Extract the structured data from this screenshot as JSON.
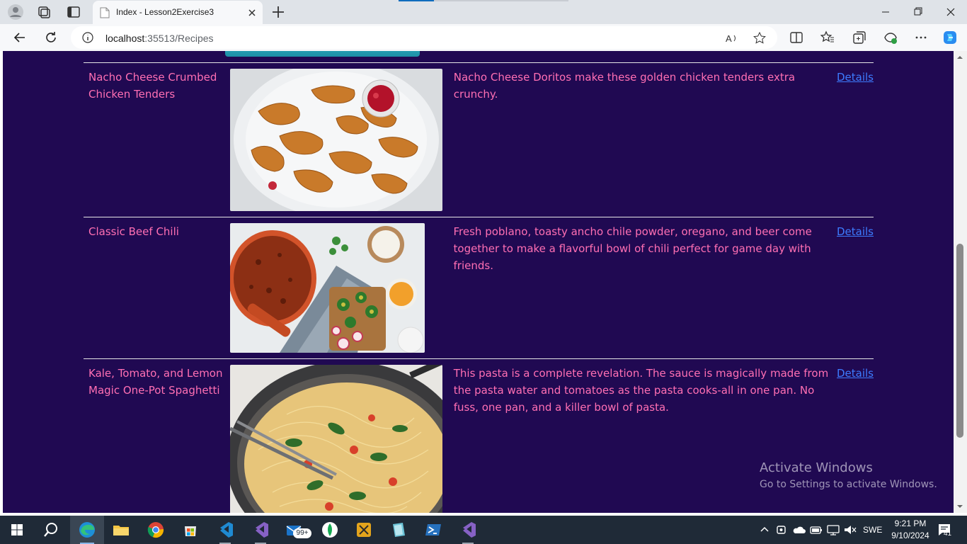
{
  "browser": {
    "tab_title": "Index - Lesson2Exercise3",
    "url_host": "localhost",
    "url_path": ":35513/Recipes"
  },
  "recipes": [
    {
      "name": "Nacho Cheese Crumbed Chicken Tenders",
      "description": "Nacho Cheese Doritos make these golden chicken tenders extra crunchy.",
      "link_label": "Details",
      "image": "fried-chicken-tenders-photo"
    },
    {
      "name": "Classic Beef Chili",
      "description": "Fresh poblano, toasty ancho chile powder, oregano, and beer come together to make a flavorful bowl of chili perfect for game day with friends.",
      "link_label": "Details",
      "image": "beef-chili-pot-photo"
    },
    {
      "name": "Kale, Tomato, and Lemon Magic One-Pot Spaghetti",
      "description": "This pasta is a complete revelation. The sauce is magically made from the pasta water and tomatoes as the pasta cooks-all in one pan. No fuss, one pan, and a killer bowl of pasta.",
      "link_label": "Details",
      "image": "spaghetti-pan-photo"
    }
  ],
  "watermark": {
    "title": "Activate Windows",
    "subtitle": "Go to Settings to activate Windows."
  },
  "taskbar": {
    "mail_badge": "99+",
    "language": "SWE",
    "time": "9:21 PM",
    "date": "9/10/2024",
    "notification_count": "41"
  },
  "colors": {
    "page_background": "#200952",
    "recipe_text": "#ff6fb3",
    "link": "#3d7cff"
  }
}
